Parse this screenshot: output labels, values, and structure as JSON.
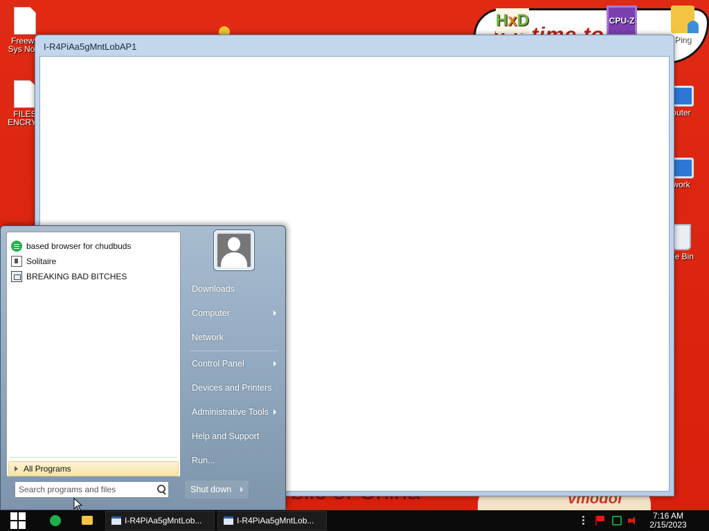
{
  "desktop": {
    "icons": [
      {
        "label_line1": "Freewa",
        "label_line2": "Sys Note",
        "icon": "document-icon"
      },
      {
        "label_line1": "FILES",
        "label_line2": "ENCRYP",
        "icon": "document-icon"
      },
      {
        "label_line1": "",
        "label_line2": "",
        "icon": "hxd-icon"
      },
      {
        "label_line1": "CPU-Z",
        "label_line2": "",
        "icon": "cpuz-icon"
      },
      {
        "label_line1": "Ping",
        "label_line2": "",
        "icon": "folder-icon"
      },
      {
        "label_line1": "puter",
        "label_line2": "",
        "icon": "computer-icon"
      },
      {
        "label_line1": "work",
        "label_line2": "",
        "icon": "network-icon"
      },
      {
        "label_line1": "cle Bin",
        "label_line2": "",
        "icon": "recycle-bin-icon"
      }
    ],
    "wallpaper_texts": {
      "banner": "it's time to",
      "bottom": "blic of China",
      "bottom_right": "vmodol"
    }
  },
  "window": {
    "title": "I-R4PiAa5gMntLobAP1"
  },
  "start_menu": {
    "programs": [
      {
        "label": "based browser for chudbuds",
        "icon": "chat-icon"
      },
      {
        "label": "Solitaire",
        "icon": "solitaire-icon"
      },
      {
        "label": "BREAKING BAD BITCHES",
        "icon": "app-icon"
      }
    ],
    "all_programs": "All Programs",
    "search_placeholder": "Search programs and files",
    "right_items": [
      {
        "label": "Downloads",
        "submenu": false
      },
      {
        "label": "Computer",
        "submenu": true
      },
      {
        "label": "Network",
        "submenu": false
      },
      {
        "label": "Control Panel",
        "submenu": true
      },
      {
        "label": "Devices and Printers",
        "submenu": false
      },
      {
        "label": "Administrative Tools",
        "submenu": true
      },
      {
        "label": "Help and Support",
        "submenu": false
      },
      {
        "label": "Run...",
        "submenu": false
      }
    ],
    "shutdown": "Shut down"
  },
  "taskbar": {
    "tasks": [
      {
        "label": "I-R4PiAa5gMntLob..."
      },
      {
        "label": "I-R4PiAa5gMntLob..."
      }
    ],
    "clock": {
      "time": "7:16 AM",
      "date": "2/15/2023"
    }
  },
  "colors": {
    "wallpaper": "#dd2211",
    "taskbar": "#0b0b0b",
    "all_programs_highlight": "#f6e4a8"
  }
}
